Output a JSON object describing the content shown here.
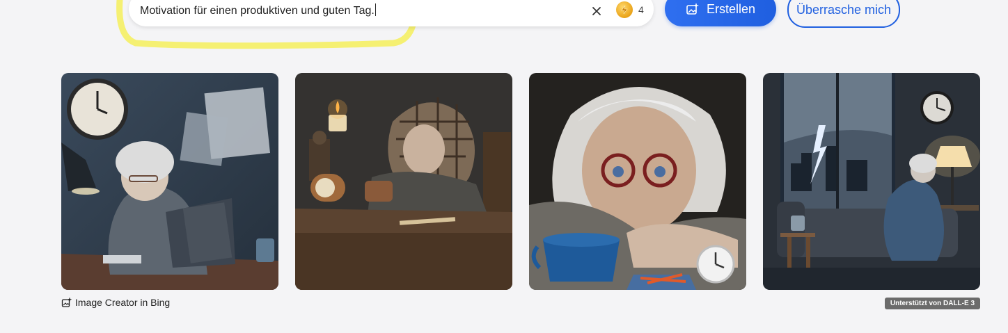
{
  "search": {
    "value": "Motivation für einen produktiven und guten Tag.",
    "boost_count": "4"
  },
  "buttons": {
    "create": "Erstellen",
    "surprise": "Überrasche mich"
  },
  "icons": {
    "clear": "close-icon",
    "boost": "lightning-coin-icon",
    "create": "image-sparkle-icon",
    "brand": "image-sparkle-icon"
  },
  "colors": {
    "accent": "#1f5fe0",
    "highlight": "#f5f064",
    "background": "#f4f4f6"
  },
  "gallery": {
    "images": [
      {
        "id": "image-1"
      },
      {
        "id": "image-2"
      },
      {
        "id": "image-3"
      },
      {
        "id": "image-4"
      }
    ]
  },
  "footer": {
    "brand": "Image Creator in Bing",
    "powered_by": "Unterstützt von DALL-E 3"
  }
}
